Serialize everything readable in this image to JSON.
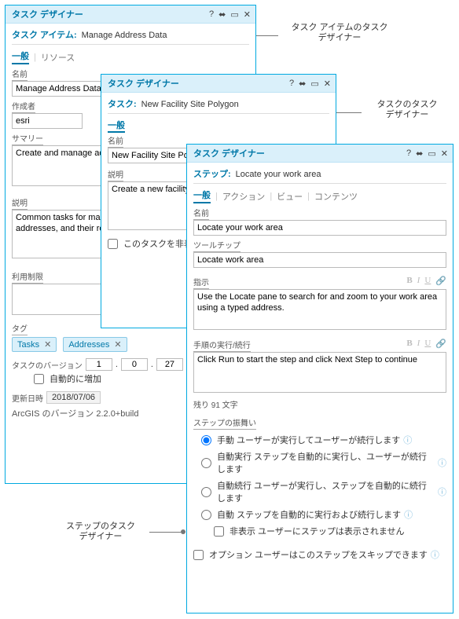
{
  "callouts": {
    "c1a": "タスク アイテムのタスク",
    "c1b": "デザイナー",
    "c2a": "タスクのタスク",
    "c2b": "デザイナー",
    "c3a": "ステップのタスク",
    "c3b": "デザイナー"
  },
  "panel1": {
    "title": "タスク デザイナー",
    "itemLabel": "タスク アイテム:",
    "itemValue": "Manage Address Data",
    "tabs": {
      "general": "一般",
      "resource": "リソース"
    },
    "name": {
      "label": "名前",
      "value": "Manage Address Data"
    },
    "author": {
      "label": "作成者",
      "value": "esri"
    },
    "summary": {
      "label": "サマリー",
      "value": "Create and manage address data."
    },
    "desc": {
      "label": "説明",
      "value": "Common tasks for managing centerlines with ranges, addresses, and their related assets."
    },
    "usage": {
      "label": "利用制限"
    },
    "tags": {
      "label": "タグ",
      "items": [
        "Tasks",
        "Addresses"
      ]
    },
    "version": {
      "label": "タスクのバージョン",
      "a": "1",
      "b": "0",
      "c": "27",
      "auto": "自動的に増加"
    },
    "updated": {
      "label": "更新日時",
      "value": "2018/07/06"
    },
    "arcgis": "ArcGIS のバージョン   2.2.0+build"
  },
  "panel2": {
    "title": "タスク デザイナー",
    "taskLabel": "タスク:",
    "taskValue": "New Facility Site Polygon",
    "section": "一般",
    "name": {
      "label": "名前",
      "value": "New Facility Site Polygon"
    },
    "desc": {
      "label": "説明",
      "value": "Create a new facility site polygon."
    },
    "hide": "このタスクを非表示"
  },
  "panel3": {
    "title": "タスク デザイナー",
    "stepLabel": "ステップ:",
    "stepValue": "Locate your work area",
    "tabs": {
      "general": "一般",
      "action": "アクション",
      "view": "ビュー",
      "contents": "コンテンツ"
    },
    "name": {
      "label": "名前",
      "value": "Locate your work area"
    },
    "tooltip": {
      "label": "ツールチップ",
      "value": "Locate work area"
    },
    "instr": {
      "label": "指示",
      "value": "Use the Locate pane to search for and zoom to your work area using a typed address."
    },
    "runcont": {
      "label": "手順の実行/続行",
      "value": "Click Run to start the step and click Next Step to continue"
    },
    "remaining": "残り 91 文字",
    "behave": {
      "label": "ステップの振舞い",
      "r1": "手動 ユーザーが実行してユーザーが続行します",
      "r2": "自動実行 ステップを自動的に実行し、ユーザーが続行します",
      "r3": "自動続行 ユーザーが実行し、ステップを自動的に続行します",
      "r4": "自動 ステップを自動的に実行および続行します",
      "hide": "非表示   ユーザーにステップは表示されません"
    },
    "optional": "オプション ユーザーはこのステップをスキップできます"
  },
  "icons": {
    "q": "?",
    "pin": "⬌",
    "min": "▭",
    "close": "✕",
    "tagx": "✕",
    "info": "ⓘ",
    "radio": "○",
    "radioSel": "●"
  }
}
